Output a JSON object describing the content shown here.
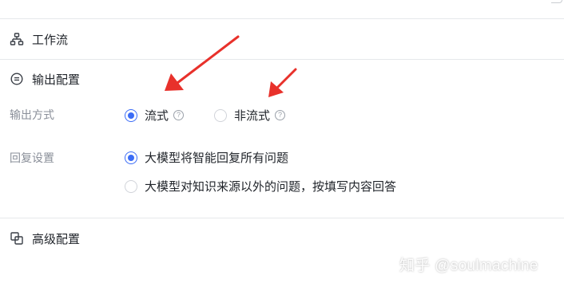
{
  "sections": {
    "workflow": {
      "title": "工作流",
      "icon": "workflow-icon"
    },
    "output": {
      "title": "输出配置",
      "icon": "output-config-icon"
    },
    "advanced": {
      "title": "高级配置",
      "icon": "advanced-config-icon"
    }
  },
  "output_mode": {
    "label": "输出方式",
    "options": [
      {
        "label": "流式",
        "checked": true,
        "help": "?"
      },
      {
        "label": "非流式",
        "checked": false,
        "help": "?"
      }
    ]
  },
  "reply_settings": {
    "label": "回复设置",
    "options": [
      {
        "label": "大模型将智能回复所有问题",
        "checked": true
      },
      {
        "label": "大模型对知识来源以外的问题，按填写内容回答",
        "checked": false
      }
    ]
  },
  "watermark": "知乎 @soulmachine",
  "colors": {
    "accent": "#3b6cf6",
    "annotation_arrow": "#e8312b"
  }
}
